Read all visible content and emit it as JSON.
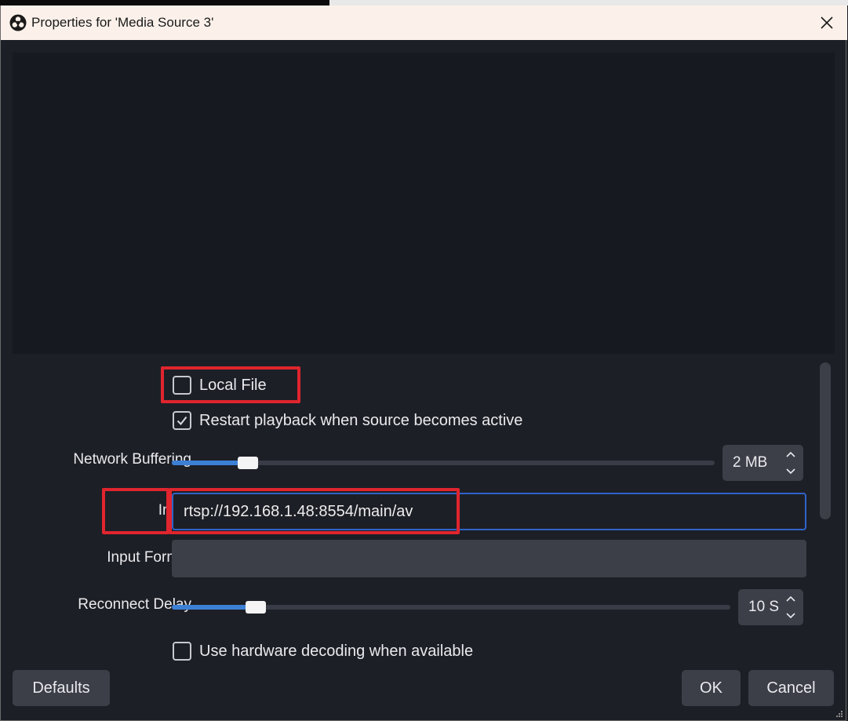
{
  "window": {
    "title": "Properties for 'Media Source 3'"
  },
  "properties": {
    "local_file": {
      "label": "Local File",
      "checked": false
    },
    "restart_playback": {
      "label": "Restart playback when source becomes active",
      "checked": true
    },
    "network_buffering": {
      "label": "Network Buffering",
      "value": "2 MB",
      "level": 0.14
    },
    "input": {
      "label": "Input",
      "value": "rtsp://192.168.1.48:8554/main/av"
    },
    "input_format": {
      "label": "Input Format",
      "value": ""
    },
    "reconnect_delay": {
      "label": "Reconnect Delay",
      "value": "10 S",
      "level": 0.15
    },
    "hardware_decoding": {
      "label": "Use hardware decoding when available",
      "checked": false
    }
  },
  "buttons": {
    "defaults": "Defaults",
    "ok": "OK",
    "cancel": "Cancel"
  },
  "colors": {
    "background": "#1d1f26",
    "accent": "#3c80d6",
    "highlight": "#e0252e",
    "titlebar": "#fbf1ea"
  },
  "icons": {
    "app": "obs-logo-icon",
    "close": "close-icon",
    "check": "checkmark-icon",
    "spin": "spin-arrows-icon",
    "grip": "resize-grip-icon"
  }
}
